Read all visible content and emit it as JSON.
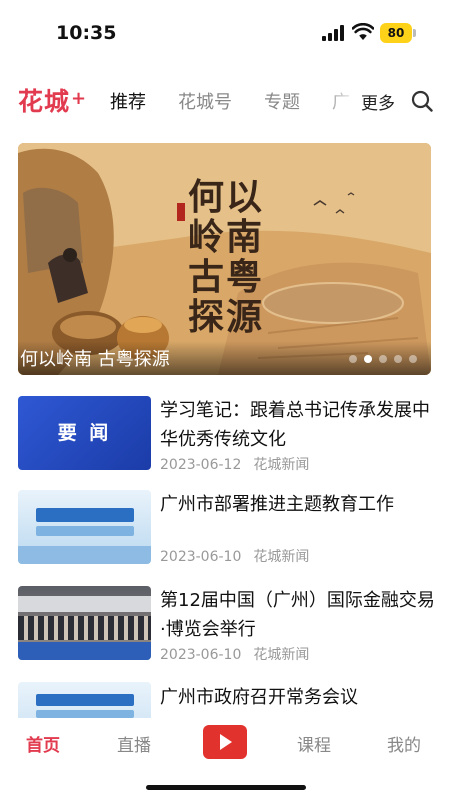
{
  "status_bar": {
    "time": "10:35",
    "battery": "80"
  },
  "top_nav": {
    "logo": "花城",
    "logo_plus": "+",
    "tabs": [
      {
        "label": "推荐",
        "active": true
      },
      {
        "label": "花城号",
        "active": false
      },
      {
        "label": "专题",
        "active": false
      },
      {
        "label": "广",
        "active": false
      }
    ],
    "more_label": "更多"
  },
  "banner": {
    "artwork_title": "何以岭南 古粤探源",
    "caption": "何以岭南 古粤探源",
    "page_count": 5,
    "active_index": 1
  },
  "news": [
    {
      "thumb_label": "要 闻",
      "title": "学习笔记：跟着总书记传承发展中华优秀传统文化",
      "date": "2023-06-12",
      "source": "花城新闻"
    },
    {
      "title": "广州市部署推进主题教育工作",
      "date": "2023-06-10",
      "source": "花城新闻"
    },
    {
      "title": "第12届中国（广州）国际金融交易·博览会举行",
      "date": "2023-06-10",
      "source": "花城新闻"
    },
    {
      "title": "广州市政府召开常务会议"
    }
  ],
  "bottom_tabs": {
    "home": "首页",
    "live": "直播",
    "course": "课程",
    "mine": "我的"
  },
  "colors": {
    "brand": "#e23a4e",
    "play": "#e2322e"
  }
}
